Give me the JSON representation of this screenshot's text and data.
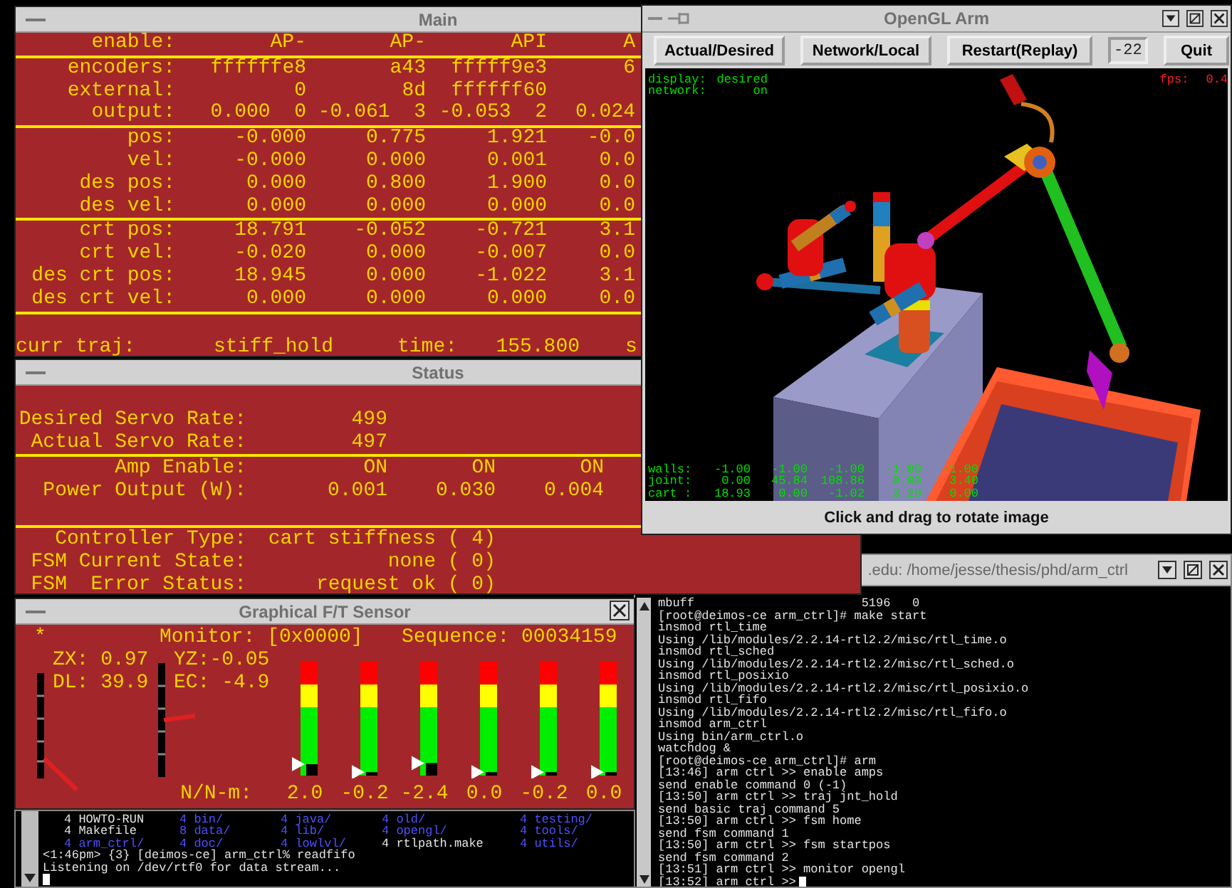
{
  "main": {
    "title": "Main",
    "sections": [
      {
        "rows": [
          {
            "label": "enable:",
            "values": [
              "AP-",
              "AP-",
              "API",
              "A"
            ]
          }
        ]
      },
      {
        "rows": [
          {
            "label": "encoders:",
            "values": [
              "ffffffe8",
              "a43",
              "fffff9e3",
              "6"
            ]
          },
          {
            "label": "external:",
            "values": [
              "0",
              "8d",
              "ffffff60"
            ]
          },
          {
            "label": "output:",
            "values": [
              "0.000  0",
              "-0.061  3",
              "-0.053  2",
              "0.024"
            ]
          }
        ]
      },
      {
        "rows": [
          {
            "label": "pos:",
            "values": [
              "-0.000",
              "0.775",
              "1.921",
              "-0.0"
            ]
          },
          {
            "label": "vel:",
            "values": [
              "-0.000",
              "0.000",
              "0.001",
              "0.0"
            ]
          },
          {
            "label": "des pos:",
            "values": [
              "0.000",
              "0.800",
              "1.900",
              "0.0"
            ]
          },
          {
            "label": "des vel:",
            "values": [
              "0.000",
              "0.000",
              "0.000",
              "0.0"
            ]
          }
        ]
      },
      {
        "rows": [
          {
            "label": "crt pos:",
            "values": [
              "18.791",
              "-0.052",
              "-0.721",
              "3.1"
            ]
          },
          {
            "label": "crt vel:",
            "values": [
              "-0.020",
              "0.000",
              "-0.007",
              "0.0"
            ]
          },
          {
            "label": "des crt pos:",
            "values": [
              "18.945",
              "0.000",
              "-1.022",
              "3.1"
            ]
          },
          {
            "label": "des crt vel:",
            "values": [
              "0.000",
              "0.000",
              "0.000",
              "0.0"
            ]
          }
        ]
      }
    ],
    "trajectory": {
      "label": "curr traj:",
      "value": "stiff_hold",
      "time_label": "time:",
      "time": "155.800",
      "cut": "s"
    }
  },
  "status": {
    "title": "Status",
    "sections": [
      {
        "kind": "rate",
        "rows": [
          {
            "label": "Desired Servo Rate:",
            "values": [
              "499"
            ]
          },
          {
            "label": "Actual Servo Rate:",
            "values": [
              "497"
            ]
          }
        ]
      },
      {
        "kind": "joint",
        "rows": [
          {
            "label": "Amp Enable:",
            "values": [
              "ON",
              "ON",
              "ON"
            ]
          },
          {
            "label": "Power Output (W):",
            "values": [
              "0.001",
              "0.030",
              "0.004"
            ]
          }
        ]
      },
      {
        "kind": "state",
        "rows": [
          {
            "label": "Controller Type:",
            "values": [
              "cart stiffness ( 4)"
            ]
          },
          {
            "label": "FSM Current State:",
            "values": [
              "none ( 0)"
            ]
          },
          {
            "label": "FSM  Error Status:",
            "values": [
              "request ok ( 0)"
            ]
          }
        ]
      }
    ]
  },
  "ft_sensor": {
    "title": "Graphical F/T Sensor",
    "marker": "*",
    "monitor": "Monitor: [0x0000]",
    "sequence": "Sequence: 00034159",
    "readouts": [
      "ZX: 0.97",
      "YZ:-0.05",
      "DL: 39.9",
      "EC: -4.9"
    ],
    "unit_label": "N/N-m:",
    "bars": [
      {
        "reading": "2.0",
        "level": 0.1
      },
      {
        "reading": "-0.2",
        "level": 0.03
      },
      {
        "reading": "-2.4",
        "level": 0.11
      },
      {
        "reading": "0.0",
        "level": 0.03
      },
      {
        "reading": "-0.2",
        "level": 0.03
      },
      {
        "reading": "0.0",
        "level": 0.03
      }
    ]
  },
  "shell_terminal": {
    "listing": [
      [
        {
          "size": "4",
          "name": "HOWTO-RUN",
          "kind": "file"
        },
        {
          "size": "4",
          "name": "bin/",
          "kind": "dir"
        },
        {
          "size": "4",
          "name": "java/",
          "kind": "dir"
        },
        {
          "size": "4",
          "name": "old/",
          "kind": "dir"
        },
        {
          "size": "4",
          "name": "testing/",
          "kind": "dir"
        }
      ],
      [
        {
          "size": "4",
          "name": "Makefile",
          "kind": "file"
        },
        {
          "size": "8",
          "name": "data/",
          "kind": "dir"
        },
        {
          "size": "4",
          "name": "lib/",
          "kind": "dir"
        },
        {
          "size": "4",
          "name": "opengl/",
          "kind": "dir"
        },
        {
          "size": "4",
          "name": "tools/",
          "kind": "dir"
        }
      ],
      [
        {
          "size": "4",
          "name": "arm_ctrl/",
          "kind": "dir"
        },
        {
          "size": "4",
          "name": "doc/",
          "kind": "dir"
        },
        {
          "size": "4",
          "name": "lowlvl/",
          "kind": "dir"
        },
        {
          "size": "4",
          "name": "rtlpath.make",
          "kind": "file"
        },
        {
          "size": "4",
          "name": "utils/",
          "kind": "dir"
        }
      ]
    ],
    "lines": [
      "<1:46pm> {3} [deimos-ce] arm_ctrl% readfifo",
      "Listening on /dev/rtf0 for data stream..."
    ]
  },
  "root_terminal": {
    "title": ".edu: /home/jesse/thesis/phd/arm_ctrl",
    "lines": [
      "mbuff                       5196   0",
      "[root@deimos-ce arm_ctrl]# make start",
      "insmod rtl_time",
      "Using /lib/modules/2.2.14-rtl2.2/misc/rtl_time.o",
      "insmod rtl_sched",
      "Using /lib/modules/2.2.14-rtl2.2/misc/rtl_sched.o",
      "insmod rtl_posixio",
      "Using /lib/modules/2.2.14-rtl2.2/misc/rtl_posixio.o",
      "insmod rtl_fifo",
      "Using /lib/modules/2.2.14-rtl2.2/misc/rtl_fifo.o",
      "insmod arm_ctrl",
      "Using bin/arm_ctrl.o",
      "watchdog &",
      "[root@deimos-ce arm_ctrl]# arm",
      "[13:46] arm ctrl >> enable amps",
      "send enable command 0 (-1)",
      "[13:50] arm ctrl >> traj jnt_hold",
      "send basic traj command 5",
      "[13:50] arm ctrl >> fsm home",
      "send fsm command 1",
      "[13:50] arm ctrl >> fsm startpos",
      "send fsm command 2",
      "[13:51] arm ctrl >> monitor opengl",
      "[13:52] arm ctrl >>"
    ]
  },
  "opengl": {
    "title": "OpenGL Arm",
    "toolbar": [
      {
        "kind": "button",
        "label": "Actual/Desired"
      },
      {
        "kind": "button",
        "label": "Network/Local"
      },
      {
        "kind": "button",
        "label": "Restart(Replay)"
      },
      {
        "kind": "field",
        "value": "-22"
      },
      {
        "kind": "button",
        "label": "Quit"
      }
    ],
    "info": [
      {
        "label": "display:",
        "value": "desired"
      },
      {
        "label": "network:",
        "value": "on"
      }
    ],
    "fps": {
      "label": "fps:",
      "value": "0.4"
    },
    "readings": [
      {
        "label": "walls:",
        "values": [
          "-1.00",
          "-1.00",
          "-1.00",
          "-1.00",
          "-1.00"
        ]
      },
      {
        "label": "joint:",
        "values": [
          "0.00",
          "45.84",
          "108.86",
          "0.00",
          "3.40"
        ]
      },
      {
        "label": "cart :",
        "values": [
          "18.93",
          "0.00",
          "-1.02",
          "3.20",
          "0.00"
        ]
      }
    ],
    "hint": "Click and drag to rotate image"
  }
}
